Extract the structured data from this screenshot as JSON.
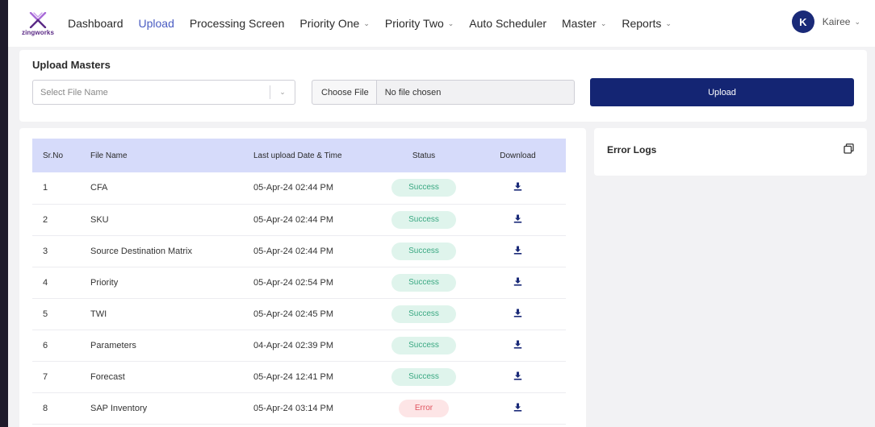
{
  "logo": {
    "text": "zingworks",
    "color": "#5b2a86"
  },
  "nav": {
    "items": [
      {
        "label": "Dashboard",
        "active": false,
        "dropdown": false
      },
      {
        "label": "Upload",
        "active": true,
        "dropdown": false
      },
      {
        "label": "Processing Screen",
        "active": false,
        "dropdown": false
      },
      {
        "label": "Priority One",
        "active": false,
        "dropdown": true
      },
      {
        "label": "Priority Two",
        "active": false,
        "dropdown": true
      },
      {
        "label": "Auto Scheduler",
        "active": false,
        "dropdown": false
      },
      {
        "label": "Master",
        "active": false,
        "dropdown": true
      },
      {
        "label": "Reports",
        "active": false,
        "dropdown": true
      }
    ],
    "chevron": "⌄",
    "active_color": "#4a5cc2"
  },
  "user": {
    "initial": "K",
    "name": "Kairee",
    "avatar_color": "#1a2a78"
  },
  "upload": {
    "title": "Upload Masters",
    "select_placeholder": "Select File Name",
    "choose_file_label": "Choose File",
    "no_file_text": "No file chosen",
    "upload_label": "Upload",
    "button_color": "#142573"
  },
  "table": {
    "headers": [
      "Sr.No",
      "File Name",
      "Last upload Date & Time",
      "Status",
      "Download"
    ],
    "header_color": "#d6dbfa",
    "rows": [
      {
        "sr": "1",
        "file": "CFA",
        "date": "05-Apr-24 02:44 PM",
        "status": "Success"
      },
      {
        "sr": "2",
        "file": "SKU",
        "date": "05-Apr-24 02:44 PM",
        "status": "Success"
      },
      {
        "sr": "3",
        "file": "Source Destination Matrix",
        "date": "05-Apr-24 02:44 PM",
        "status": "Success"
      },
      {
        "sr": "4",
        "file": "Priority",
        "date": "05-Apr-24 02:54 PM",
        "status": "Success"
      },
      {
        "sr": "5",
        "file": "TWI",
        "date": "05-Apr-24 02:45 PM",
        "status": "Success"
      },
      {
        "sr": "6",
        "file": "Parameters",
        "date": "04-Apr-24 02:39 PM",
        "status": "Success"
      },
      {
        "sr": "7",
        "file": "Forecast",
        "date": "05-Apr-24 12:41 PM",
        "status": "Success"
      },
      {
        "sr": "8",
        "file": "SAP Inventory",
        "date": "05-Apr-24 03:14 PM",
        "status": "Error"
      }
    ],
    "download_icon": "download-icon"
  },
  "error_logs": {
    "title": "Error Logs",
    "icon": "copy-icon"
  }
}
